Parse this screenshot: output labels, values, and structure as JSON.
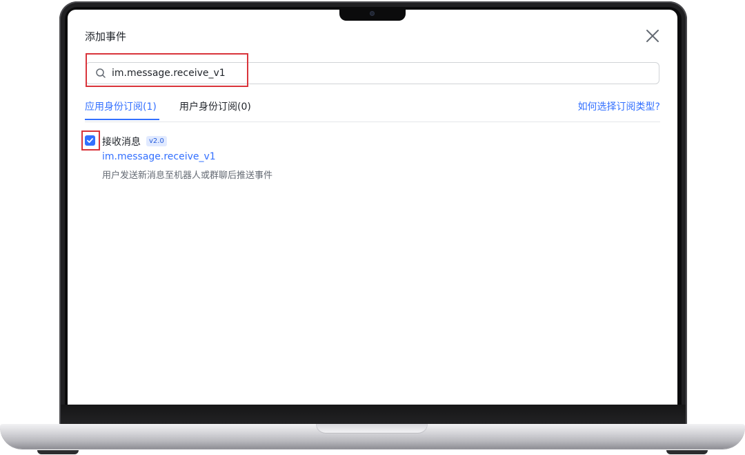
{
  "modal": {
    "title": "添加事件",
    "close_icon": "close-icon"
  },
  "search": {
    "value": "im.message.receive_v1",
    "icon": "search-icon"
  },
  "tabs": [
    {
      "label": "应用身份订阅(1)",
      "active": true
    },
    {
      "label": "用户身份订阅(0)",
      "active": false
    }
  ],
  "help_link": "如何选择订阅类型?",
  "event": {
    "checked": true,
    "name": "接收消息",
    "version": "v2.0",
    "key": "im.message.receive_v1",
    "description": "用户发送新消息至机器人或群聊后推送事件"
  },
  "colors": {
    "accent": "#3370ff",
    "highlight": "#d9333a",
    "text": "#1f2329",
    "secondary_text": "#646a73"
  }
}
